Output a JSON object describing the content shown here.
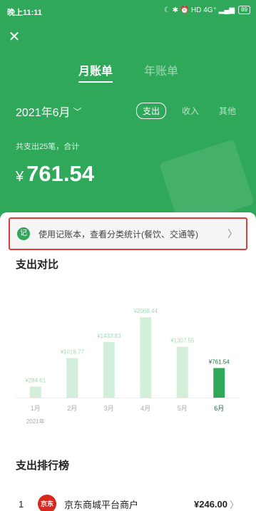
{
  "statusbar": {
    "time": "晚上11:11",
    "icons_text": "☾ ✱ ⏰ HD 4G⁺ ▂▄▆",
    "battery": "89"
  },
  "tabs": {
    "month": "月账单",
    "year": "年账单"
  },
  "period": {
    "label": "2021年6月"
  },
  "types": {
    "expense": "支出",
    "income": "收入",
    "other": "其他"
  },
  "summary": {
    "text": "共支出25笔，合计",
    "currency": "¥",
    "amount": "761.54"
  },
  "notice": {
    "icon": "记",
    "text": "使用记账本，查看分类统计(餐饮、交通等)"
  },
  "compare": {
    "title": "支出对比"
  },
  "chart_data": {
    "type": "bar",
    "categories": [
      "1月",
      "2月",
      "3月",
      "4月",
      "5月",
      "6月"
    ],
    "values": [
      284.61,
      1018.77,
      1433.83,
      2068.44,
      1307.55,
      761.54
    ],
    "value_labels": [
      "¥284.61",
      "¥1018.77",
      "¥1433.83",
      "¥2068.44",
      "¥1307.55",
      "¥761.54"
    ],
    "year_label": "2021年",
    "ylim": [
      0,
      2200
    ],
    "highlight_index": 5,
    "colors": {
      "bar": "#d4efd9",
      "highlight": "#2fa85a",
      "label": "#a5d9b2",
      "highlight_label": "#1b6e39",
      "tick": "#aaaaaa"
    }
  },
  "ranking": {
    "title": "支出排行榜",
    "items": [
      {
        "rank": "1",
        "logo": "京东",
        "name": "京东商城平台商户",
        "amount": "¥246.00"
      }
    ]
  }
}
